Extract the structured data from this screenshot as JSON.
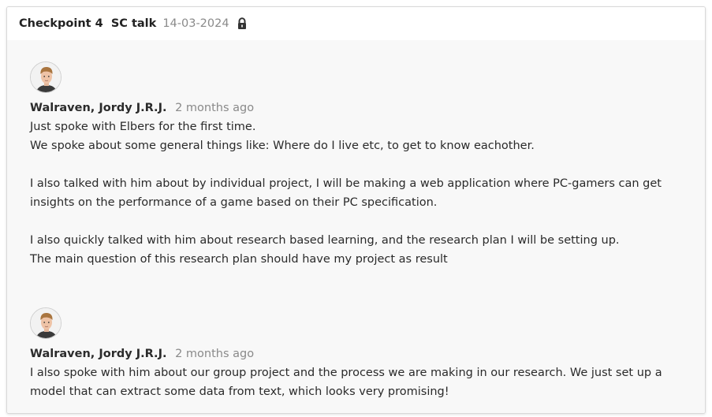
{
  "header": {
    "title": "Checkpoint 4  SC talk",
    "date": "14-03-2024",
    "lock_icon": "lock-icon"
  },
  "comments": [
    {
      "author": "Walraven, Jordy J.R.J.",
      "when": "2 months ago",
      "lines": [
        "Just spoke with Elbers for the first time.",
        "We spoke about some general things like: Where do I live etc, to get to know eachother.",
        "",
        "I also talked with him about by individual project, I will be making a web application where PC-gamers can get insights on the performance of a game based on their PC specification.",
        "",
        "I also quickly talked with him about research based learning, and the research plan I will be setting up.",
        "The main question of this research plan should have my project as result"
      ]
    },
    {
      "author": "Walraven, Jordy J.R.J.",
      "when": "2 months ago",
      "lines": [
        "I also spoke with him about our group project and the process we are making in our research. We just set up a model that can extract some data from text, which looks very promising!"
      ]
    }
  ]
}
